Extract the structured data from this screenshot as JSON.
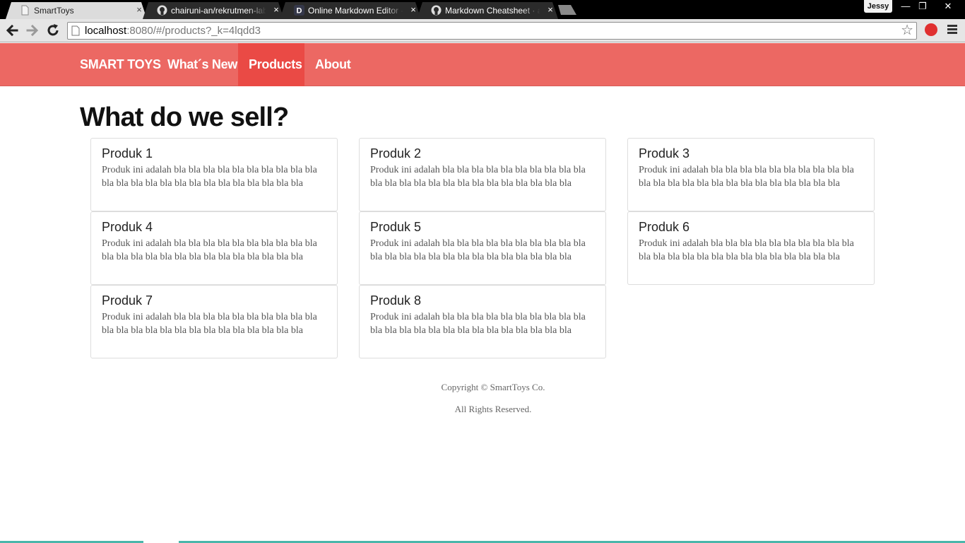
{
  "browser": {
    "tabs": [
      {
        "title": "SmartToys",
        "icon": "page-icon",
        "active": true
      },
      {
        "title": "chairuni-an/rekrutmen-lab",
        "icon": "github-icon",
        "active": false
      },
      {
        "title": "Online Markdown Editor - Dillinger",
        "icon": "dillinger-icon",
        "active": false
      },
      {
        "title": "Markdown Cheatsheet · adam-p",
        "icon": "github-icon",
        "active": false
      }
    ],
    "tab_close_glyph": "×",
    "profile_name": "Jessy",
    "window_controls": {
      "minimize": "—",
      "restore": "❐",
      "close": "✕"
    },
    "url_host": "localhost",
    "url_path": ":8080/#/products?_k=4lqdd3",
    "star_glyph": "☆"
  },
  "navbar": {
    "brand": "SMART TOYS",
    "links": [
      {
        "label": "What´s New",
        "active": false
      },
      {
        "label": "Products",
        "active": true
      },
      {
        "label": "About",
        "active": false
      }
    ],
    "color": "#ec6863",
    "active_color": "#ea4a45"
  },
  "main": {
    "heading": "What do we sell?",
    "products": [
      {
        "name": "Produk 1",
        "description": "Produk ini adalah bla bla bla bla bla bla bla bla bla bla bla bla bla bla bla bla bla bla bla bla bla bla bla bla"
      },
      {
        "name": "Produk 2",
        "description": "Produk ini adalah bla bla bla bla bla bla bla bla bla bla bla bla bla bla bla bla bla bla bla bla bla bla bla bla"
      },
      {
        "name": "Produk 3",
        "description": "Produk ini adalah bla bla bla bla bla bla bla bla bla bla bla bla bla bla bla bla bla bla bla bla bla bla bla bla"
      },
      {
        "name": "Produk 4",
        "description": "Produk ini adalah bla bla bla bla bla bla bla bla bla bla bla bla bla bla bla bla bla bla bla bla bla bla bla bla"
      },
      {
        "name": "Produk 5",
        "description": "Produk ini adalah bla bla bla bla bla bla bla bla bla bla bla bla bla bla bla bla bla bla bla bla bla bla bla bla"
      },
      {
        "name": "Produk 6",
        "description": "Produk ini adalah bla bla bla bla bla bla bla bla bla bla bla bla bla bla bla bla bla bla bla bla bla bla bla bla"
      },
      {
        "name": "Produk 7",
        "description": "Produk ini adalah bla bla bla bla bla bla bla bla bla bla bla bla bla bla bla bla bla bla bla bla bla bla bla bla"
      },
      {
        "name": "Produk 8",
        "description": "Produk ini adalah bla bla bla bla bla bla bla bla bla bla bla bla bla bla bla bla bla bla bla bla bla bla bla bla"
      }
    ]
  },
  "footer": {
    "copyright": "Copyright © SmartToys Co.",
    "rights": "All Rights Reserved."
  }
}
